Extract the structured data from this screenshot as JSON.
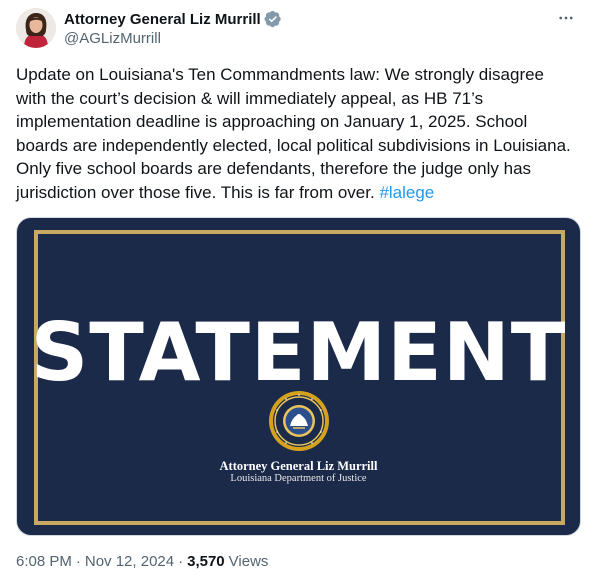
{
  "author": {
    "display_name": "Attorney General Liz Murrill",
    "handle": "@AGLizMurrill",
    "verified": true
  },
  "tweet": {
    "text": "Update on Louisiana's Ten Commandments law: We strongly disagree with the court’s decision & will immediately appeal, as HB 71’s implementation deadline is approaching on January 1, 2025. School boards are independently elected, local political subdivisions in Louisiana.  Only five school boards are defendants, therefore the judge only has jurisdiction over those five. This is far from over. ",
    "hashtag": "#lalege"
  },
  "media": {
    "headline": "STATEMENT",
    "org_name": "Attorney General Liz Murrill",
    "org_sub": "Louisiana Department of Justice"
  },
  "meta": {
    "time": "6:08 PM",
    "date": "Nov 12, 2024",
    "separator": "·",
    "views_count": "3,570",
    "views_label": "Views"
  },
  "icons": {
    "more": "more-horizontal-icon",
    "verified": "verified-badge-icon",
    "seal": "louisiana-doj-seal-icon"
  },
  "colors": {
    "link": "#1d9bf0",
    "media_background": "#1c2a4a",
    "frame_gold": "#c9a862",
    "verified_badge": "#829aab"
  }
}
